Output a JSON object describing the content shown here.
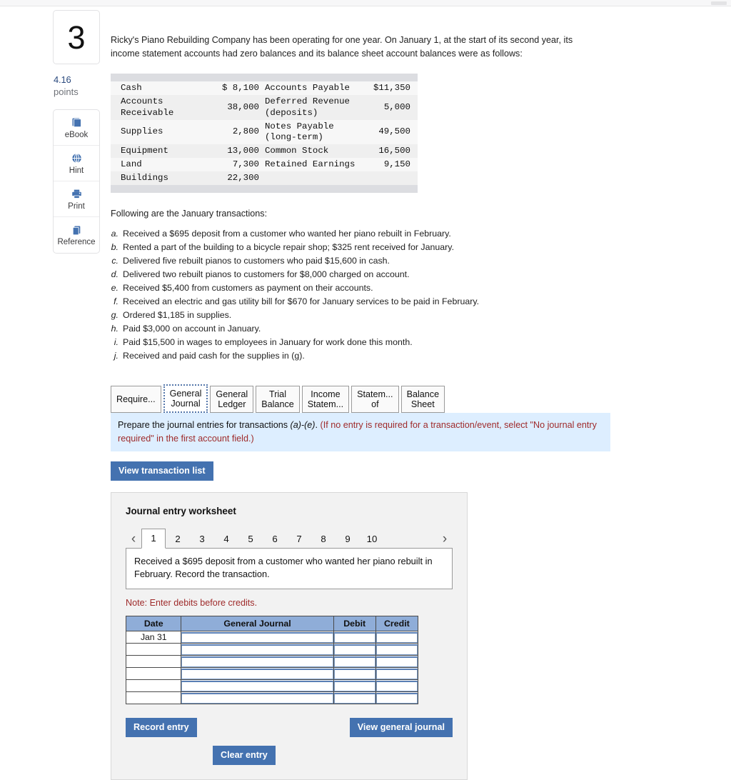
{
  "question": {
    "number": "3",
    "points_value": "4.16",
    "points_label": "points"
  },
  "tools": [
    {
      "icon": "book-icon",
      "label": "eBook"
    },
    {
      "icon": "hint-globe-icon",
      "label": "Hint"
    },
    {
      "icon": "printer-icon",
      "label": "Print"
    },
    {
      "icon": "reference-copy-icon",
      "label": "Reference"
    }
  ],
  "intro": "Ricky's Piano Rebuilding Company has been operating for one year. On January 1, at the start of its second year, its income statement accounts had zero balances and its balance sheet account balances were as follows:",
  "balance_table": {
    "rows": [
      {
        "left_name": "Cash",
        "left_amount": "$ 8,100",
        "right_name": "Accounts Payable",
        "right_amount": "$11,350"
      },
      {
        "left_name": "Accounts\nReceivable",
        "left_amount": "38,000",
        "right_name": "Deferred Revenue\n(deposits)",
        "right_amount": "5,000"
      },
      {
        "left_name": "Supplies",
        "left_amount": "2,800",
        "right_name": "Notes Payable\n(long-term)",
        "right_amount": "49,500"
      },
      {
        "left_name": "Equipment",
        "left_amount": "13,000",
        "right_name": "Common Stock",
        "right_amount": "16,500"
      },
      {
        "left_name": "Land",
        "left_amount": "7,300",
        "right_name": "Retained Earnings",
        "right_amount": "9,150"
      },
      {
        "left_name": "Buildings",
        "left_amount": "22,300",
        "right_name": "",
        "right_amount": ""
      }
    ]
  },
  "transactions_heading": "Following are the January transactions:",
  "transactions": [
    {
      "letter": "a.",
      "text": "Received a $695 deposit from a customer who wanted her piano rebuilt in February."
    },
    {
      "letter": "b.",
      "text": "Rented a part of the building to a bicycle repair shop; $325 rent received for January."
    },
    {
      "letter": "c.",
      "text": "Delivered five rebuilt pianos to customers who paid $15,600 in cash."
    },
    {
      "letter": "d.",
      "text": "Delivered two rebuilt pianos to customers for $8,000 charged on account."
    },
    {
      "letter": "e.",
      "text": "Received $5,400 from customers as payment on their accounts."
    },
    {
      "letter": "f.",
      "text": "Received an electric and gas utility bill for $670 for January services to be paid in February."
    },
    {
      "letter": "g.",
      "text": "Ordered $1,185 in supplies."
    },
    {
      "letter": "h.",
      "text": "Paid $3,000 on account in January."
    },
    {
      "letter": "i.",
      "text": "Paid $15,500 in wages to employees in January for work done this month."
    },
    {
      "letter": "j.",
      "text": "Received and paid cash for the supplies in (g)."
    }
  ],
  "tabs": [
    {
      "label": "Require...",
      "active": false
    },
    {
      "label": "General\nJournal",
      "active": true
    },
    {
      "label": "General\nLedger",
      "active": false
    },
    {
      "label": "Trial\nBalance",
      "active": false
    },
    {
      "label": "Income\nStatem...",
      "active": false
    },
    {
      "label": "Statem...\nof",
      "active": false
    },
    {
      "label": "Balance\nSheet",
      "active": false
    }
  ],
  "instruction": {
    "black_part": "Prepare the journal entries for transactions ",
    "black_italic": "(a)-(e)",
    "black_tail": ". ",
    "red_part": "(If no entry is required for a transaction/event, select \"No journal entry required\" in the first account field.)"
  },
  "view_transaction_list_label": "View transaction list",
  "worksheet": {
    "title": "Journal entry worksheet",
    "prev_arrow": "‹",
    "next_arrow": "›",
    "pages": [
      "1",
      "2",
      "3",
      "4",
      "5",
      "6",
      "7",
      "8",
      "9",
      "10"
    ],
    "active_page": "1",
    "scenario": "Received a $695 deposit from a customer who wanted her piano rebuilt in February. Record the transaction.",
    "note": "Note: Enter debits before credits."
  },
  "journal_grid": {
    "headers": [
      "Date",
      "General Journal",
      "Debit",
      "Credit"
    ],
    "rows": [
      {
        "date": "Jan 31",
        "account": "",
        "debit": "",
        "credit": ""
      },
      {
        "date": "",
        "account": "",
        "debit": "",
        "credit": ""
      },
      {
        "date": "",
        "account": "",
        "debit": "",
        "credit": ""
      },
      {
        "date": "",
        "account": "",
        "debit": "",
        "credit": ""
      },
      {
        "date": "",
        "account": "",
        "debit": "",
        "credit": ""
      },
      {
        "date": "",
        "account": "",
        "debit": "",
        "credit": ""
      }
    ]
  },
  "footer_buttons": {
    "record_entry": "Record entry",
    "clear_entry": "Clear entry",
    "view_general_journal": "View general journal"
  },
  "colors": {
    "accent_blue": "#4472b0",
    "banner_blue": "#ddeeff",
    "header_blue": "#8fadd8",
    "warn_red": "#9e2a2a"
  }
}
